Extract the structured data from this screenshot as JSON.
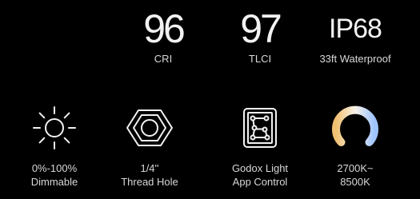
{
  "stats": [
    {
      "value": "96",
      "label": "CRI"
    },
    {
      "value": "97",
      "label": "TLCI"
    },
    {
      "value": "IP68",
      "label": "33ft Waterproof"
    }
  ],
  "features": [
    {
      "icon": "sun-brightness-icon",
      "line1": "0%-100%",
      "line2": "Dimmable"
    },
    {
      "icon": "hex-nut-icon",
      "line1": "1/4''",
      "line2": "Thread Hole"
    },
    {
      "icon": "app-network-icon",
      "line1": "Godox Light",
      "line2": "App Control"
    },
    {
      "icon": "color-temperature-ring-icon",
      "line1": "2700K~",
      "line2": "8500K"
    }
  ],
  "colors": {
    "background": "#000000",
    "text": "#d8d8d8",
    "warm": "#f0c070",
    "cool": "#9ec4ff"
  }
}
